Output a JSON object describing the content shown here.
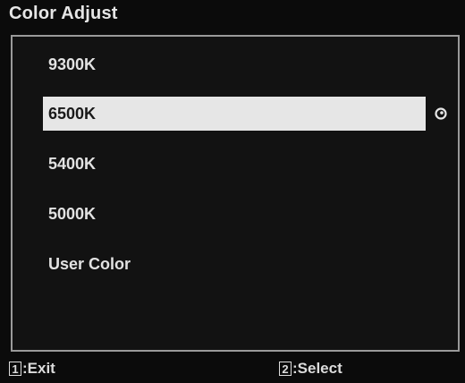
{
  "title": "Color Adjust",
  "menu": {
    "items": [
      {
        "label": "9300K"
      },
      {
        "label": "6500K"
      },
      {
        "label": "5400K"
      },
      {
        "label": "5000K"
      },
      {
        "label": "User Color"
      }
    ],
    "selected_index": 1
  },
  "icons": {
    "current_marker": "current-setting-icon"
  },
  "footer": {
    "exit": {
      "key": "1",
      "label": ":Exit"
    },
    "select": {
      "key": "2",
      "label": ":Select"
    }
  },
  "colors": {
    "background": "#0b0b0b",
    "highlight": "#e6e6e6",
    "frame": "#9a9a9a",
    "text": "#e2e2e2"
  }
}
